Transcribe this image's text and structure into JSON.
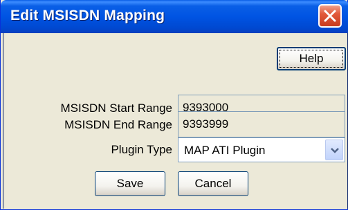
{
  "window": {
    "title": "Edit MSISDN Mapping",
    "close_icon": "close-icon"
  },
  "toolbar": {
    "help_label": "Help"
  },
  "form": {
    "start_range": {
      "label": "MSISDN Start Range",
      "value": "9393000"
    },
    "end_range": {
      "label": "MSISDN End Range",
      "value": "9393999"
    },
    "plugin_type": {
      "label": "Plugin Type",
      "value": "MAP ATI Plugin",
      "arrow_icon": "chevron-down-icon"
    }
  },
  "actions": {
    "save_label": "Save",
    "cancel_label": "Cancel"
  },
  "colors": {
    "titlebar": "#0054e3",
    "dialog_bg": "#ece9d8",
    "close_button": "#e2593b"
  }
}
